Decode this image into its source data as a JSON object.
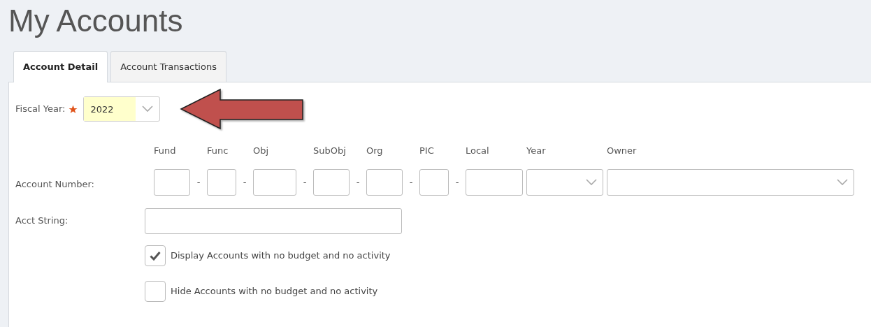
{
  "page": {
    "title": "My Accounts"
  },
  "tabs": [
    {
      "label": "Account Detail",
      "selected": true
    },
    {
      "label": "Account Transactions",
      "selected": false
    }
  ],
  "fiscal_year": {
    "label": "Fiscal Year:",
    "required": true,
    "value": "2022"
  },
  "account_number": {
    "label": "Account Number:",
    "segments": [
      {
        "label": "Fund",
        "kind": "text",
        "separator": "-"
      },
      {
        "label": "Func",
        "kind": "text",
        "separator": "-"
      },
      {
        "label": "Obj",
        "kind": "text",
        "separator": "-"
      },
      {
        "label": "SubObj",
        "kind": "text",
        "separator": "-"
      },
      {
        "label": "Org",
        "kind": "text",
        "separator": "-"
      },
      {
        "label": "PIC",
        "kind": "text",
        "separator": "-"
      },
      {
        "label": "Local",
        "kind": "text"
      },
      {
        "label": "Year",
        "kind": "select"
      },
      {
        "label": "Owner",
        "kind": "select"
      }
    ]
  },
  "acct_string": {
    "label": "Acct String:"
  },
  "options": [
    {
      "label": "Display Accounts with no budget and no activity",
      "checked": true
    },
    {
      "label": "Hide Accounts with no budget and no activity",
      "checked": false
    }
  ]
}
